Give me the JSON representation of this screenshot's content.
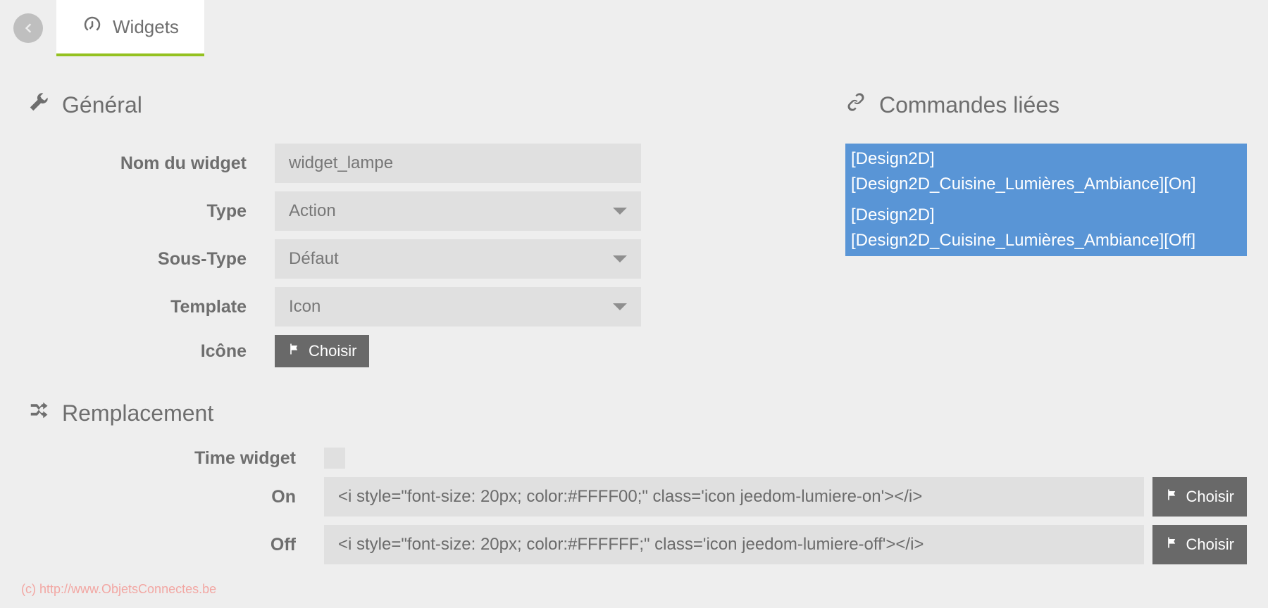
{
  "topbar": {
    "tab_label": "Widgets"
  },
  "general": {
    "title": "Général",
    "labels": {
      "name": "Nom du widget",
      "type": "Type",
      "subtype": "Sous-Type",
      "template": "Template",
      "icon": "Icône"
    },
    "values": {
      "name": "widget_lampe",
      "type": "Action",
      "subtype": "Défaut",
      "template": "Icon"
    },
    "choose_label": "Choisir"
  },
  "replacement": {
    "title": "Remplacement",
    "labels": {
      "time_widget": "Time widget",
      "on": "On",
      "off": "Off"
    },
    "values": {
      "on": "<i style=\"font-size: 20px; color:#FFFF00;\" class='icon jeedom-lumiere-on'></i>",
      "off": "<i style=\"font-size: 20px; color:#FFFFFF;\" class='icon jeedom-lumiere-off'></i>"
    },
    "choose_label": "Choisir"
  },
  "linked": {
    "title": "Commandes liées",
    "items": [
      "[Design2D][Design2D_Cuisine_Lumières_Ambiance][On]",
      "[Design2D][Design2D_Cuisine_Lumières_Ambiance][Off]"
    ]
  },
  "watermark": "(c) http://www.ObjetsConnectes.be"
}
